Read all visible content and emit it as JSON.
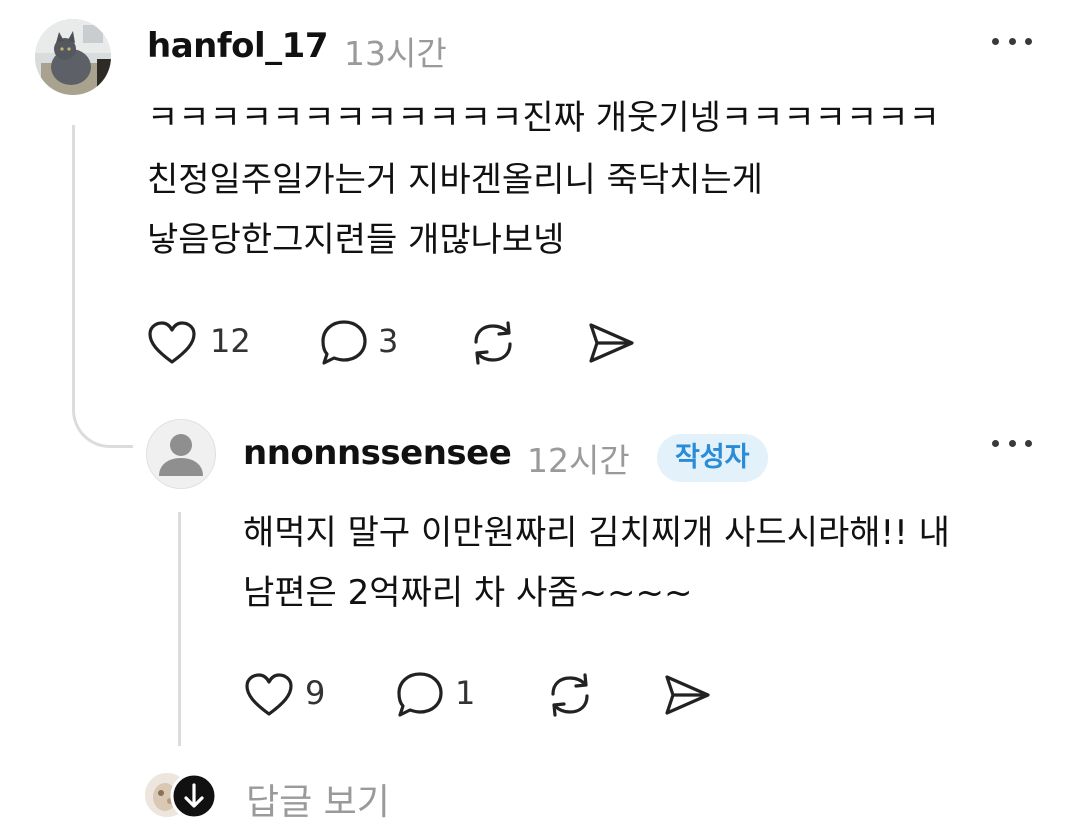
{
  "comment": {
    "username": "hanfol_17",
    "time": "13시간",
    "avatar_icon": "cat-photo-avatar",
    "lines": [
      "ㅋㅋㅋㅋㅋㅋㅋㅋㅋㅋㅋㅋ진짜 개웃기넹ㅋㅋㅋㅋㅋㅋㅋ",
      "친정일주일가는거 지바겐올리니 죽닥치는게",
      "낳음당한그지련들 개많나보넹"
    ],
    "likes": "12",
    "replies": "3"
  },
  "reply": {
    "username": "nnonnssensee",
    "time": "12시간",
    "badge": "작성자",
    "avatar_icon": "default-user-avatar",
    "lines": [
      "해먹지 말구 이만원짜리 김치찌개 사드시라해!! 내",
      "남편은 2억짜리 차 사줌~~~~"
    ],
    "likes": "9",
    "replies": "1"
  },
  "footer": {
    "view_replies_label": "답글 보기"
  },
  "colors": {
    "badge_bg": "#e3f1fb",
    "badge_text": "#2a8cd6",
    "muted_text": "#9a9a9a",
    "thread_line": "#dcdcdc"
  }
}
